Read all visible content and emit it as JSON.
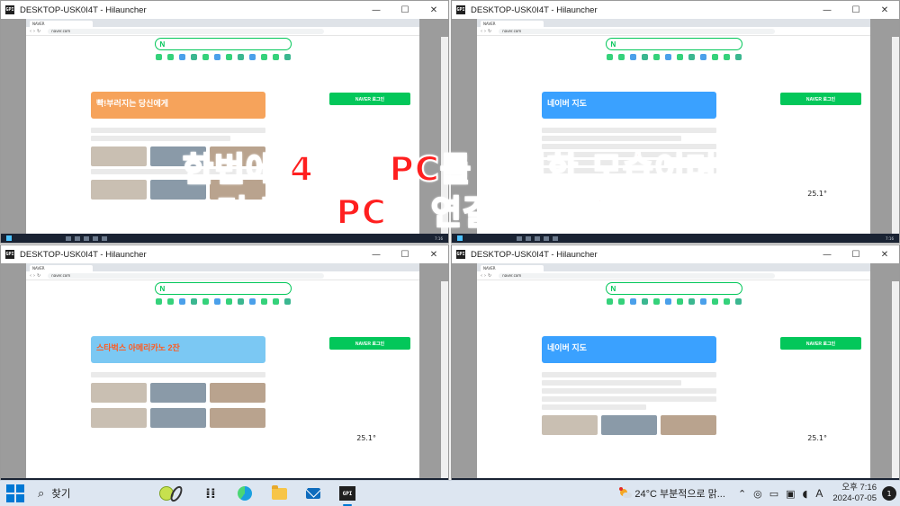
{
  "windows": [
    {
      "title": "DESKTOP-USK0I4T - Hilauncher"
    },
    {
      "title": "DESKTOP-USK0I4T - Hilauncher"
    },
    {
      "title": "DESKTOP-USK0I4T - Hilauncher"
    },
    {
      "title": "DESKTOP-USK0I4T - Hilauncher"
    }
  ],
  "window_controls": {
    "minimize": "—",
    "maximize": "☐",
    "close": "✕"
  },
  "browser": {
    "tab_title": "NAVER",
    "url": "naver.com"
  },
  "banners": [
    {
      "text": "빡!부러지는 당신에게",
      "color": "#f6a35b"
    },
    {
      "text": "네이버 지도",
      "color": "#3aa1ff"
    },
    {
      "text": "스타벅스 아메리카노 2잔",
      "color": "#7bc8f3"
    },
    {
      "text": "네이버 지도",
      "color": "#3aa1ff"
    }
  ],
  "login_button": "NAVER 로그인",
  "weather_temps": [
    "",
    "25.1°",
    "25.1°",
    "25.1°"
  ],
  "overlay": {
    "line1": "한번에 4대의 PC를 연결한 모습이며",
    "line2": "더 많은 PC도 연결가능하십니다"
  },
  "taskbar": {
    "search_label": "찾기",
    "hilauncher_label": "GPI",
    "weather_text": "24°C  부분적으로 맑...",
    "ime": "A",
    "time": "오후 7:16",
    "date": "2024-07-05",
    "notif_count": "1"
  },
  "colors": {
    "overlay_text": "#ff1f1f",
    "naver_green": "#03c75a",
    "taskbar_bg": "#dde6f1"
  }
}
